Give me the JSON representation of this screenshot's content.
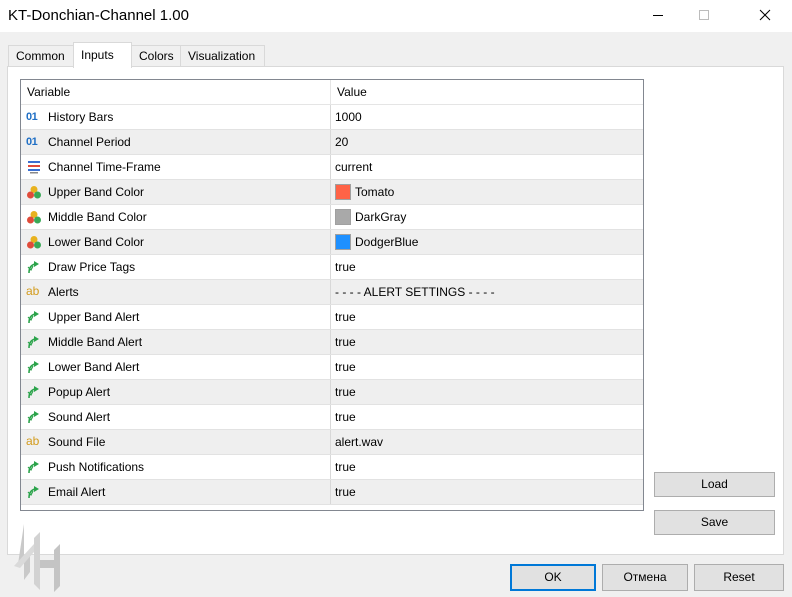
{
  "window": {
    "title": "KT-Donchian-Channel 1.00"
  },
  "tabs": [
    {
      "label": "Common",
      "active": false
    },
    {
      "label": "Inputs",
      "active": true
    },
    {
      "label": "Colors",
      "active": false
    },
    {
      "label": "Visualization",
      "active": false
    }
  ],
  "grid": {
    "header": {
      "variable": "Variable",
      "value": "Value"
    },
    "rows": [
      {
        "variable": "History Bars",
        "value": "1000",
        "icon": "integer-icon"
      },
      {
        "variable": "Channel Period",
        "value": "20",
        "icon": "integer-icon"
      },
      {
        "variable": "Channel Time-Frame",
        "value": "current",
        "icon": "timeframe-icon"
      },
      {
        "variable": "Upper Band Color",
        "value": "Tomato",
        "icon": "color-icon",
        "swatch": "#ff6347"
      },
      {
        "variable": "Middle Band Color",
        "value": "DarkGray",
        "icon": "color-icon",
        "swatch": "#a9a9a9"
      },
      {
        "variable": "Lower Band Color",
        "value": "DodgerBlue",
        "icon": "color-icon",
        "swatch": "#1e90ff"
      },
      {
        "variable": "Draw Price Tags",
        "value": "true",
        "icon": "boolean-icon"
      },
      {
        "variable": "Alerts",
        "value": "- - - - ALERT SETTINGS - - - -",
        "icon": "string-icon"
      },
      {
        "variable": "Upper Band Alert",
        "value": "true",
        "icon": "boolean-icon"
      },
      {
        "variable": "Middle Band Alert",
        "value": "true",
        "icon": "boolean-icon"
      },
      {
        "variable": "Lower Band Alert",
        "value": "true",
        "icon": "boolean-icon"
      },
      {
        "variable": "Popup Alert",
        "value": "true",
        "icon": "boolean-icon"
      },
      {
        "variable": "Sound Alert",
        "value": "true",
        "icon": "boolean-icon"
      },
      {
        "variable": "Sound File",
        "value": "alert.wav",
        "icon": "string-icon"
      },
      {
        "variable": "Push Notifications",
        "value": "true",
        "icon": "boolean-icon"
      },
      {
        "variable": "Email Alert",
        "value": "true",
        "icon": "boolean-icon"
      }
    ]
  },
  "icons": {
    "integer": "01",
    "string": "ab"
  },
  "buttons": {
    "load": "Load",
    "save": "Save",
    "ok": "OK",
    "cancel": "Отмена",
    "reset": "Reset"
  },
  "colors": {
    "accent": "#0078d7",
    "row_alt": "#efefef",
    "boolean_icon": "#2aa34a",
    "integer_icon": "#1f6fc5",
    "string_icon": "#d39b1c"
  }
}
